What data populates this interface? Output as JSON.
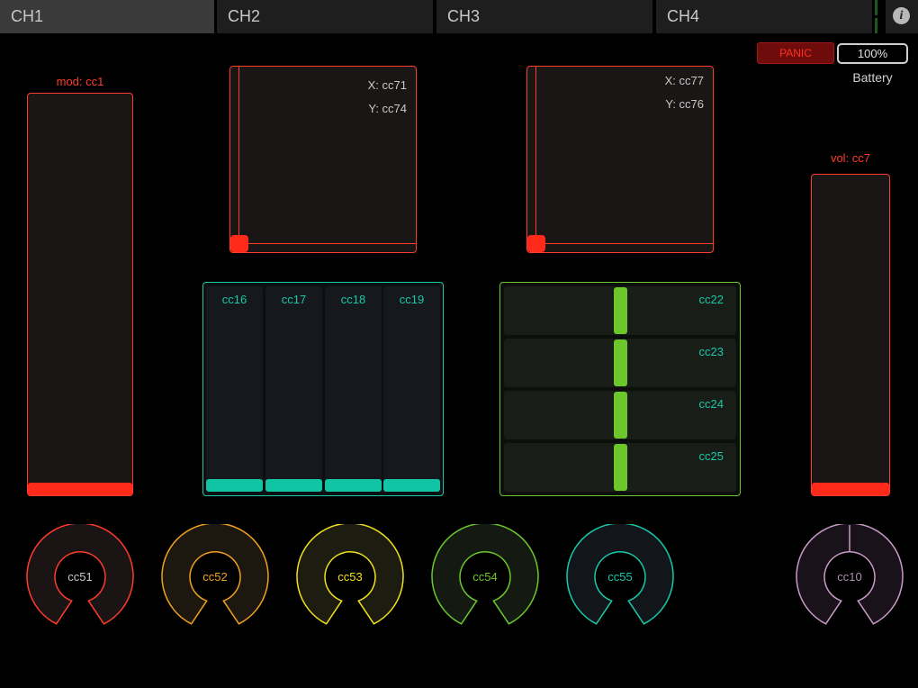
{
  "tabs": [
    {
      "label": "CH1"
    },
    {
      "label": "CH2"
    },
    {
      "label": "CH3"
    },
    {
      "label": "CH4"
    }
  ],
  "info_icon": "info-icon",
  "panic_label": "PANIC",
  "battery": {
    "value": "100%",
    "label": "Battery"
  },
  "mod_fader": {
    "label": "mod: cc1",
    "level": 0.0
  },
  "vol_fader": {
    "label": "vol: cc7",
    "level": 0.0
  },
  "xy_pads": [
    {
      "x_label": "X: cc71",
      "y_label": "Y: cc74"
    },
    {
      "x_label": "X: cc77",
      "y_label": "Y: cc76"
    }
  ],
  "multi_faders": [
    "cc16",
    "cc17",
    "cc18",
    "cc19"
  ],
  "h_faders": [
    "cc22",
    "cc23",
    "cc24",
    "cc25"
  ],
  "knobs": [
    {
      "label": "cc51",
      "color": "#ff3b2a"
    },
    {
      "label": "cc52",
      "color": "#f0a020"
    },
    {
      "label": "cc53",
      "color": "#f0e020"
    },
    {
      "label": "cc54",
      "color": "#6cc82a"
    },
    {
      "label": "cc55",
      "color": "#18c8aa"
    },
    {
      "label": "cc10",
      "color": "#c89ac8"
    }
  ],
  "colors": {
    "red": "#ff3b2a",
    "teal": "#18c8aa",
    "green": "#6cc82a"
  }
}
